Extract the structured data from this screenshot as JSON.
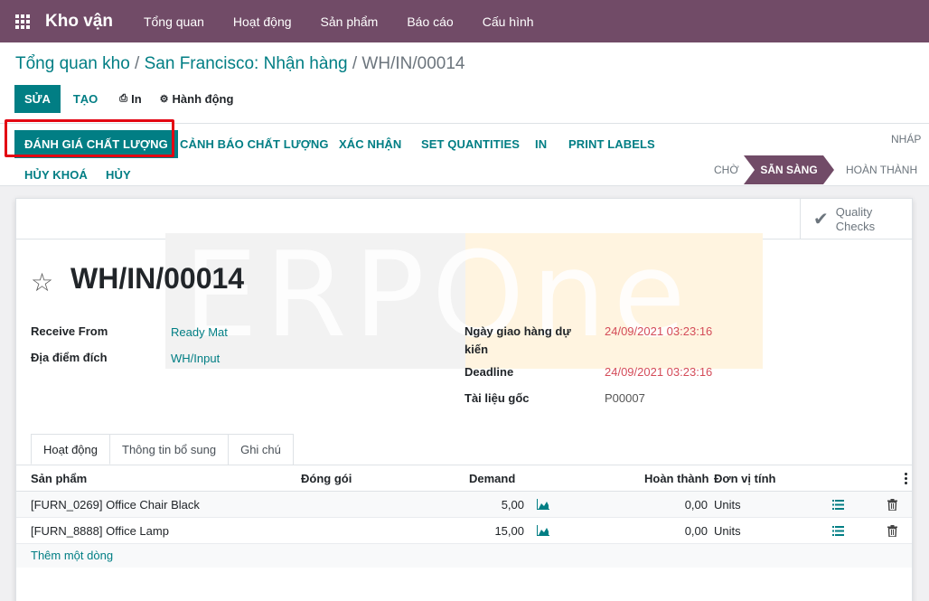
{
  "app": {
    "brand": "Kho vận",
    "menu": [
      "Tổng quan",
      "Hoạt động",
      "Sản phẩm",
      "Báo cáo",
      "Cấu hình"
    ]
  },
  "breadcrumb": {
    "part1": "Tổng quan kho",
    "part2": "San Francisco: Nhận hàng",
    "current": "WH/IN/00014",
    "separator": "/"
  },
  "control_buttons": {
    "edit": "SỬA",
    "create": "TẠO",
    "print": "In",
    "action": "Hành động"
  },
  "status_buttons": {
    "quality_check": "ĐÁNH GIÁ CHẤT LƯỢNG",
    "quality_alert": "CẢNH BÁO CHẤT LƯỢNG",
    "validate": "XÁC NHẬN",
    "set_quantities": "SET QUANTITIES",
    "print": "IN",
    "print_labels": "PRINT LABELS",
    "unreserve": "HỦY KHOÁ",
    "cancel": "HỦY"
  },
  "stages": {
    "draft": "NHÁP",
    "waiting": "CHỜ",
    "ready": "SẴN SÀNG",
    "done": "HOÀN THÀNH",
    "active": "ready"
  },
  "smart_button": {
    "quality_checks_line1": "Quality",
    "quality_checks_line2": "Checks"
  },
  "watermark": "ERPOne",
  "record": {
    "title": "WH/IN/00014",
    "fields": {
      "receive_from_label": "Receive From",
      "receive_from_value": "Ready Mat",
      "destination_label": "Địa điểm đích",
      "destination_value": "WH/Input",
      "scheduled_label_line1": "Ngày giao hàng dự",
      "scheduled_label_line2": "kiến",
      "scheduled_value": "24/09/2021 03:23:16",
      "deadline_label": "Deadline",
      "deadline_value": "24/09/2021 03:23:16",
      "source_label": "Tài liệu gốc",
      "source_value": "P00007"
    }
  },
  "tabs": [
    "Hoạt động",
    "Thông tin bổ sung",
    "Ghi chú"
  ],
  "table": {
    "headers": {
      "product": "Sản phẩm",
      "package": "Đóng gói",
      "demand": "Demand",
      "done": "Hoàn thành",
      "uom": "Đơn vị tính"
    },
    "rows": [
      {
        "product": "[FURN_0269] Office Chair Black",
        "demand": "5,00",
        "done": "0,00",
        "uom": "Units"
      },
      {
        "product": "[FURN_8888] Office Lamp",
        "demand": "15,00",
        "done": "0,00",
        "uom": "Units"
      }
    ],
    "add_line": "Thêm một dòng"
  },
  "colors": {
    "brand": "#714b67",
    "primary": "#017e84",
    "highlight": "#e30613",
    "date_red": "#d44c59"
  }
}
